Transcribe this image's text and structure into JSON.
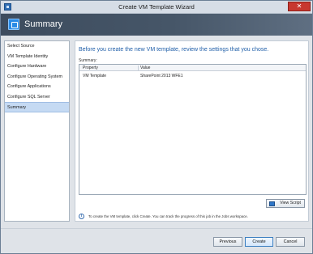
{
  "window": {
    "title": "Create VM Template Wizard",
    "close_glyph": "✕"
  },
  "header": {
    "title": "Summary",
    "icon": "template-icon"
  },
  "nav": {
    "items": [
      {
        "label": "Select Source"
      },
      {
        "label": "VM Template Identity"
      },
      {
        "label": "Configure Hardware"
      },
      {
        "label": "Configure Operating System"
      },
      {
        "label": "Configure Applications"
      },
      {
        "label": "Configure SQL Server"
      },
      {
        "label": "Summary",
        "active": true
      }
    ]
  },
  "main": {
    "title": "Before you create the new VM template, review the settings that you chose.",
    "summary_label": "Summary:",
    "grid": {
      "columns": [
        "Property",
        "Value"
      ],
      "rows": [
        [
          "VM Template",
          "SharePoint 2013 WFE1"
        ]
      ]
    },
    "view_script_label": "View Script",
    "info_text": "To create the VM template, click Create.  You can track the progress of this job in the Jobs workspace."
  },
  "footer": {
    "previous_label": "Previous",
    "create_label": "Create",
    "cancel_label": "Cancel"
  },
  "colors": {
    "accent": "#1f5ea8",
    "header_bg": "#3d4c5e",
    "close": "#c7372f"
  }
}
